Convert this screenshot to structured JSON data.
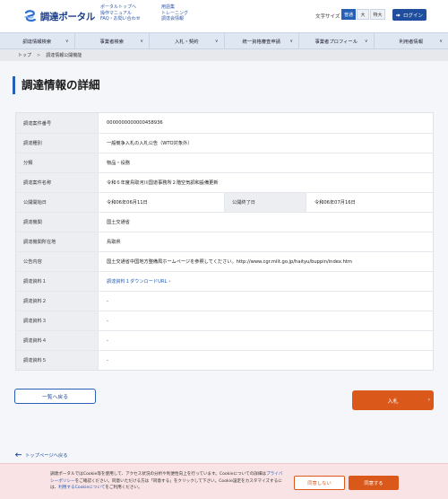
{
  "header": {
    "logo_text": "調達ポータル",
    "links_col1": [
      "ポータルトップへ",
      "操作マニュアル",
      "FAQ・お問い合わせ"
    ],
    "links_col2": [
      "用語集",
      "トレーニング",
      "調達会情報"
    ],
    "font_size_label": "文字サイズ",
    "font_sizes": [
      "普通",
      "大",
      "特大"
    ],
    "font_size_selected": "普通",
    "login_label": "ログイン"
  },
  "global_nav": {
    "items": [
      "調達情報検索",
      "事業者検索",
      "入札・契約",
      "統一資格審査申請",
      "事業者プロフィール",
      "利用者情報"
    ]
  },
  "breadcrumb": {
    "items": [
      "トップ",
      "調達情報公開機能"
    ]
  },
  "page_title": "調達情報の詳細",
  "details": {
    "rows": [
      {
        "label": "調達案件番号",
        "value": "0000000000000458936"
      },
      {
        "label": "調達種別",
        "value": "一般競争入札の入札公告（WTO対象外）"
      },
      {
        "label": "分類",
        "value": "物品・役務"
      },
      {
        "label": "調達案件名称",
        "value": "令和６年度鳥取河川国道事務所２階空気調和設備更新"
      },
      {
        "label": "公開開始日",
        "value": "令和06年06月11日",
        "label2": "公開終了日",
        "value2": "令和06年07月16日"
      },
      {
        "label": "調達機関",
        "value": "国土交通省"
      },
      {
        "label": "調達機関所在地",
        "value": "鳥取県"
      },
      {
        "label": "公告内容",
        "value": "国土交通省中国地方整備局ホームページを参照してください。http://www.cgr.mlit.go.jp/haityu/buppin/index.htm"
      },
      {
        "label": "調達資料１",
        "value": "調達資料１ダウンロードURL"
      },
      {
        "label": "調達資料２",
        "value": "-"
      },
      {
        "label": "調達資料３",
        "value": "-"
      },
      {
        "label": "調達資料４",
        "value": "-"
      },
      {
        "label": "調達資料５",
        "value": "-"
      }
    ]
  },
  "actions": {
    "back_label": "一覧へ戻る",
    "bid_label": "入札"
  },
  "page_top_label": "トップページへ戻る",
  "cookie_banner": {
    "text_1": "調達ポータルではCookie等を使用して、アクセス状況の分析や利便性向上を行っています。Cookieについての詳細は",
    "privacy_link": "プライバシーポリシー",
    "text_2": "をご確認ください。同意いただける方は「同意する」をクリックして下さい。Cookie設定をカスタマイズするには、",
    "settings_link": "利用するCookieについて",
    "text_3": "をご利用ください。",
    "decline_label": "同意しない",
    "agree_label": "同意する"
  },
  "colors": {
    "brand": "#1c3f8c",
    "accent": "#2a5fb5",
    "action": "#d9581a"
  }
}
